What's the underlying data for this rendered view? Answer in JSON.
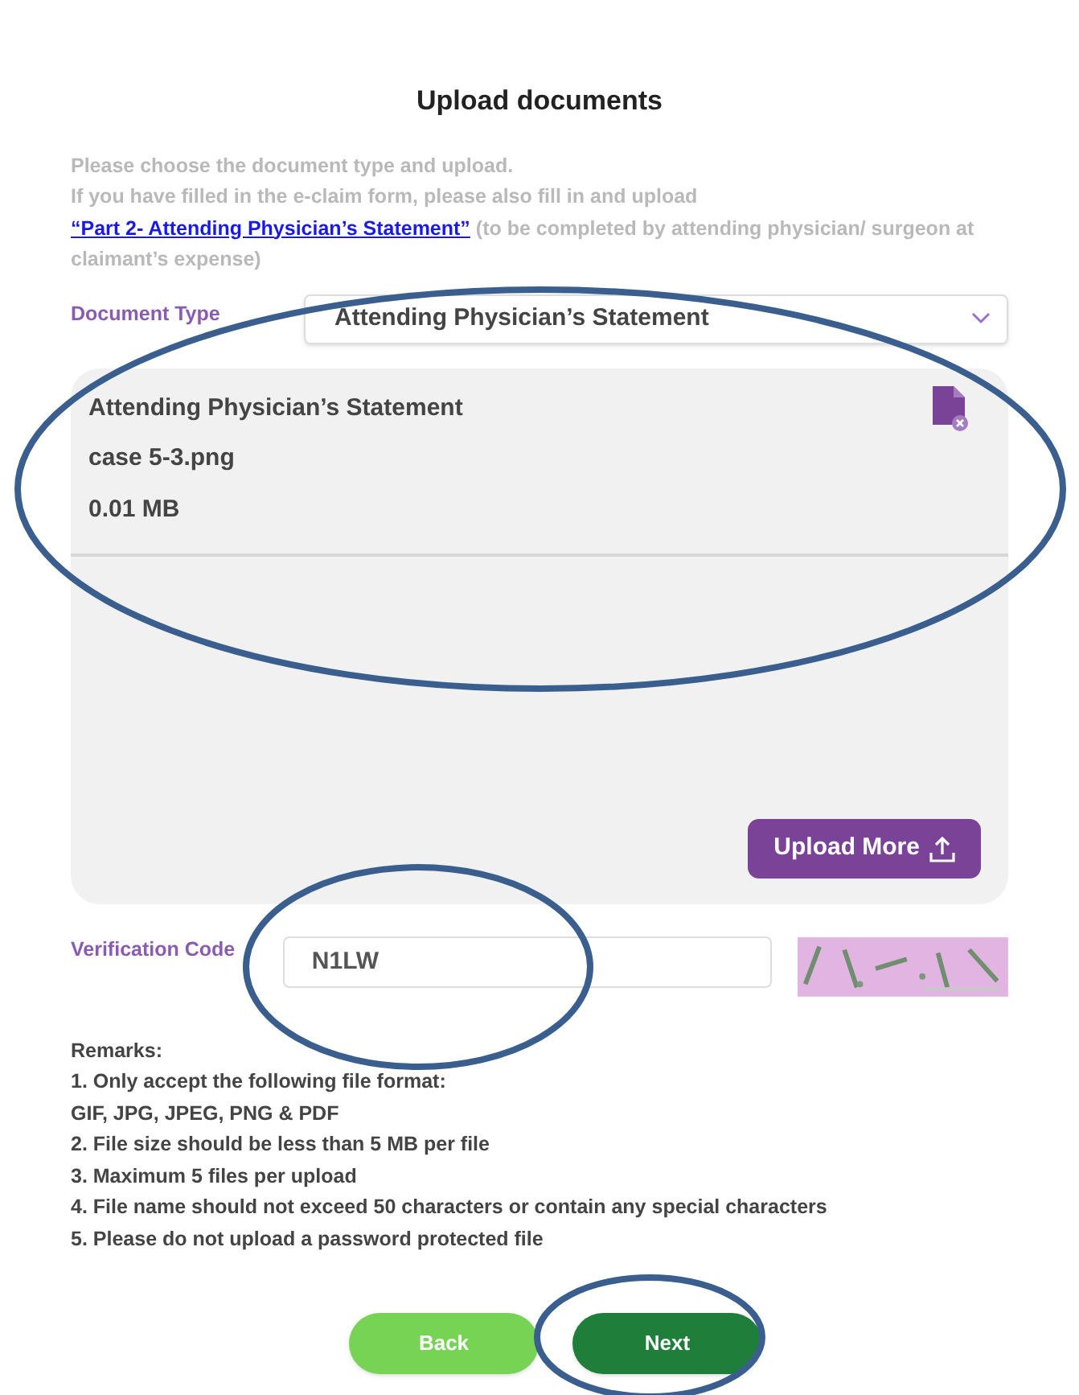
{
  "title": "Upload documents",
  "intro": {
    "line_1": "Please choose the document type and upload.",
    "line_2": "If you have filled in the e-claim form, please also fill in and upload",
    "link": "“Part 2- Attending Physician’s Statement”",
    "after_link": "(to be completed by attending physician/ surgeon at claimant’s expense)"
  },
  "document_type": {
    "label": "Document Type",
    "value": "Attending Physician’s Statement"
  },
  "files": [
    {
      "document": "Attending Physician’s Statement",
      "file_name": "case 5-3.png",
      "size": "0.01 MB"
    }
  ],
  "upload_more": "Upload More",
  "verification": {
    "label": "Verification Code",
    "value": "N1LW"
  },
  "remarks": [
    "Remarks:",
    "1. Only accept the following file format:",
    "GIF, JPG, JPEG, PNG & PDF",
    "2. File size should be less than 5 MB per file",
    "3. Maximum 5 files per upload",
    "4. File name should not exceed 50 characters or contain any special characters",
    "5. Please do not upload a password protected file"
  ],
  "buttons": [
    {
      "label": "Back",
      "kind": "secondary"
    },
    {
      "label": "Next",
      "kind": "primary"
    }
  ]
}
